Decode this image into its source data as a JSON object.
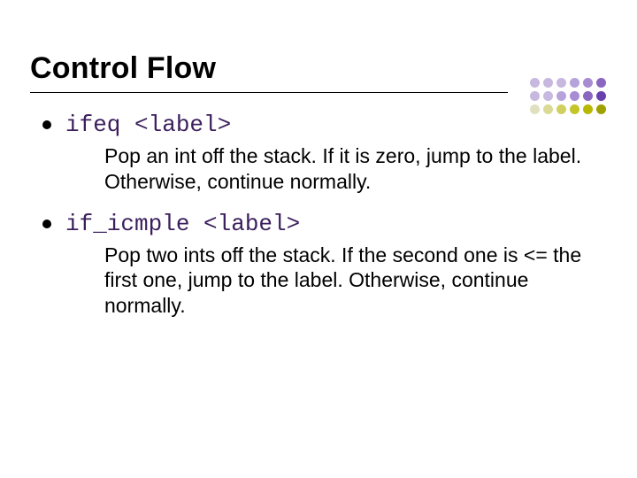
{
  "title": "Control Flow",
  "items": [
    {
      "code": "ifeq <label>",
      "description": "Pop an int off the stack. If it is zero, jump to the label. Otherwise, continue normally."
    },
    {
      "code": "if_icmple <label>",
      "description": "Pop two ints off the stack. If the second one is <= the first one, jump to the label. Otherwise, continue normally."
    }
  ],
  "dot_colors": [
    "#c7b8e0",
    "#c7b8e0",
    "#c7b8e0",
    "#b7a3db",
    "#a88cd3",
    "#8a66c0",
    "#c7b8e0",
    "#c7b8e0",
    "#b7a3db",
    "#a88cd3",
    "#8a66c0",
    "#6a3fb0",
    "#e0e0c0",
    "#dada96",
    "#d0d060",
    "#c5c528",
    "#b8b800",
    "#a0a000"
  ]
}
